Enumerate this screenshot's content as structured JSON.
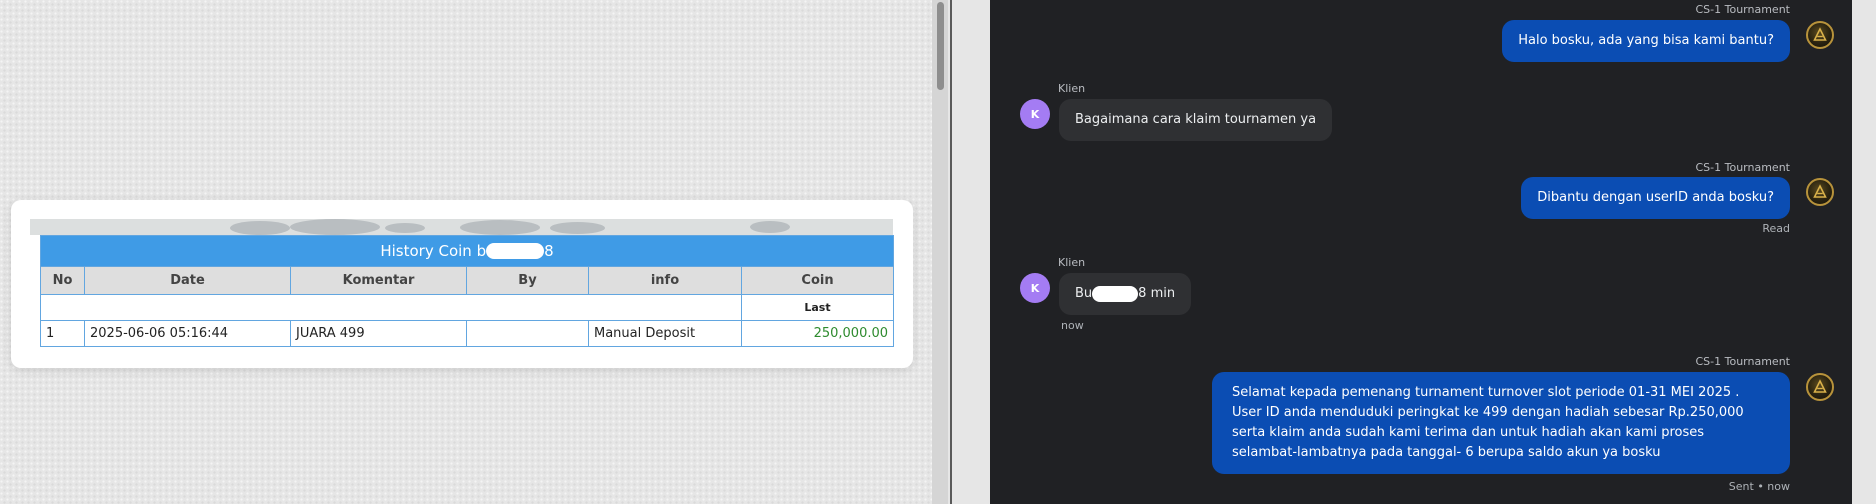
{
  "history": {
    "title_prefix": "History Coin b",
    "title_suffix": "8",
    "columns": [
      "No",
      "Date",
      "Komentar",
      "By",
      "info",
      "Coin"
    ],
    "sub_label": "Last",
    "rows": [
      {
        "no": "1",
        "date": "2025-06-06 05:16:44",
        "komentar": "JUARA 499",
        "by": "",
        "info": "Manual Deposit",
        "coin": "250,000.00"
      }
    ]
  },
  "chat": {
    "messages": [
      {
        "sender": "CS-1 Tournament",
        "role": "agent",
        "text": "Halo bosku, ada yang bisa kami bantu?"
      },
      {
        "sender": "Klien",
        "role": "client",
        "avatar": "K",
        "text": "Bagaimana cara klaim tournamen ya"
      },
      {
        "sender": "CS-1 Tournament",
        "role": "agent",
        "text": "Dibantu dengan userID anda bosku?",
        "status": "Read"
      },
      {
        "sender": "Klien",
        "role": "client",
        "avatar": "K",
        "text_prefix": "Bu",
        "text_suffix": "8 min",
        "time": "now"
      },
      {
        "sender": "CS-1 Tournament",
        "role": "agent",
        "text": "Selamat kepada pemenang turnament turnover slot periode 01-31 MEI 2025 . User ID anda menduduki peringkat ke 499 dengan hadiah sebesar Rp.250,000 serta klaim anda sudah kami terima dan untuk hadiah akan kami proses selambat-lambatnya pada tanggal- 6 berupa saldo akun ya bosku",
        "status": "Sent • now"
      }
    ]
  },
  "colors": {
    "agent_bubble": "#0b4db3",
    "client_bubble": "#2f3033",
    "chat_bg": "#202124",
    "table_header": "#3f9be6",
    "coin_value": "#2e8b2e",
    "avatar_k": "#a47cf3"
  },
  "icons": {
    "agent_avatar": "gold-emblem-icon"
  }
}
